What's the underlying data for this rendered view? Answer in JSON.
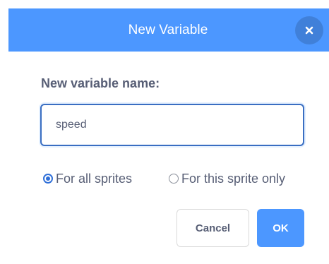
{
  "dialog": {
    "title": "New Variable",
    "close_icon": "close-x-icon"
  },
  "form": {
    "name_label": "New variable name:",
    "name_value": "speed",
    "scope_options": [
      {
        "label": "For all sprites",
        "selected": true
      },
      {
        "label": "For this sprite only",
        "selected": false
      }
    ]
  },
  "actions": {
    "cancel_label": "Cancel",
    "ok_label": "OK"
  },
  "colors": {
    "header": "#4c97ff",
    "primary_button": "#4c97ff",
    "text": "#575e75",
    "input_border": "#3a6ec2"
  }
}
